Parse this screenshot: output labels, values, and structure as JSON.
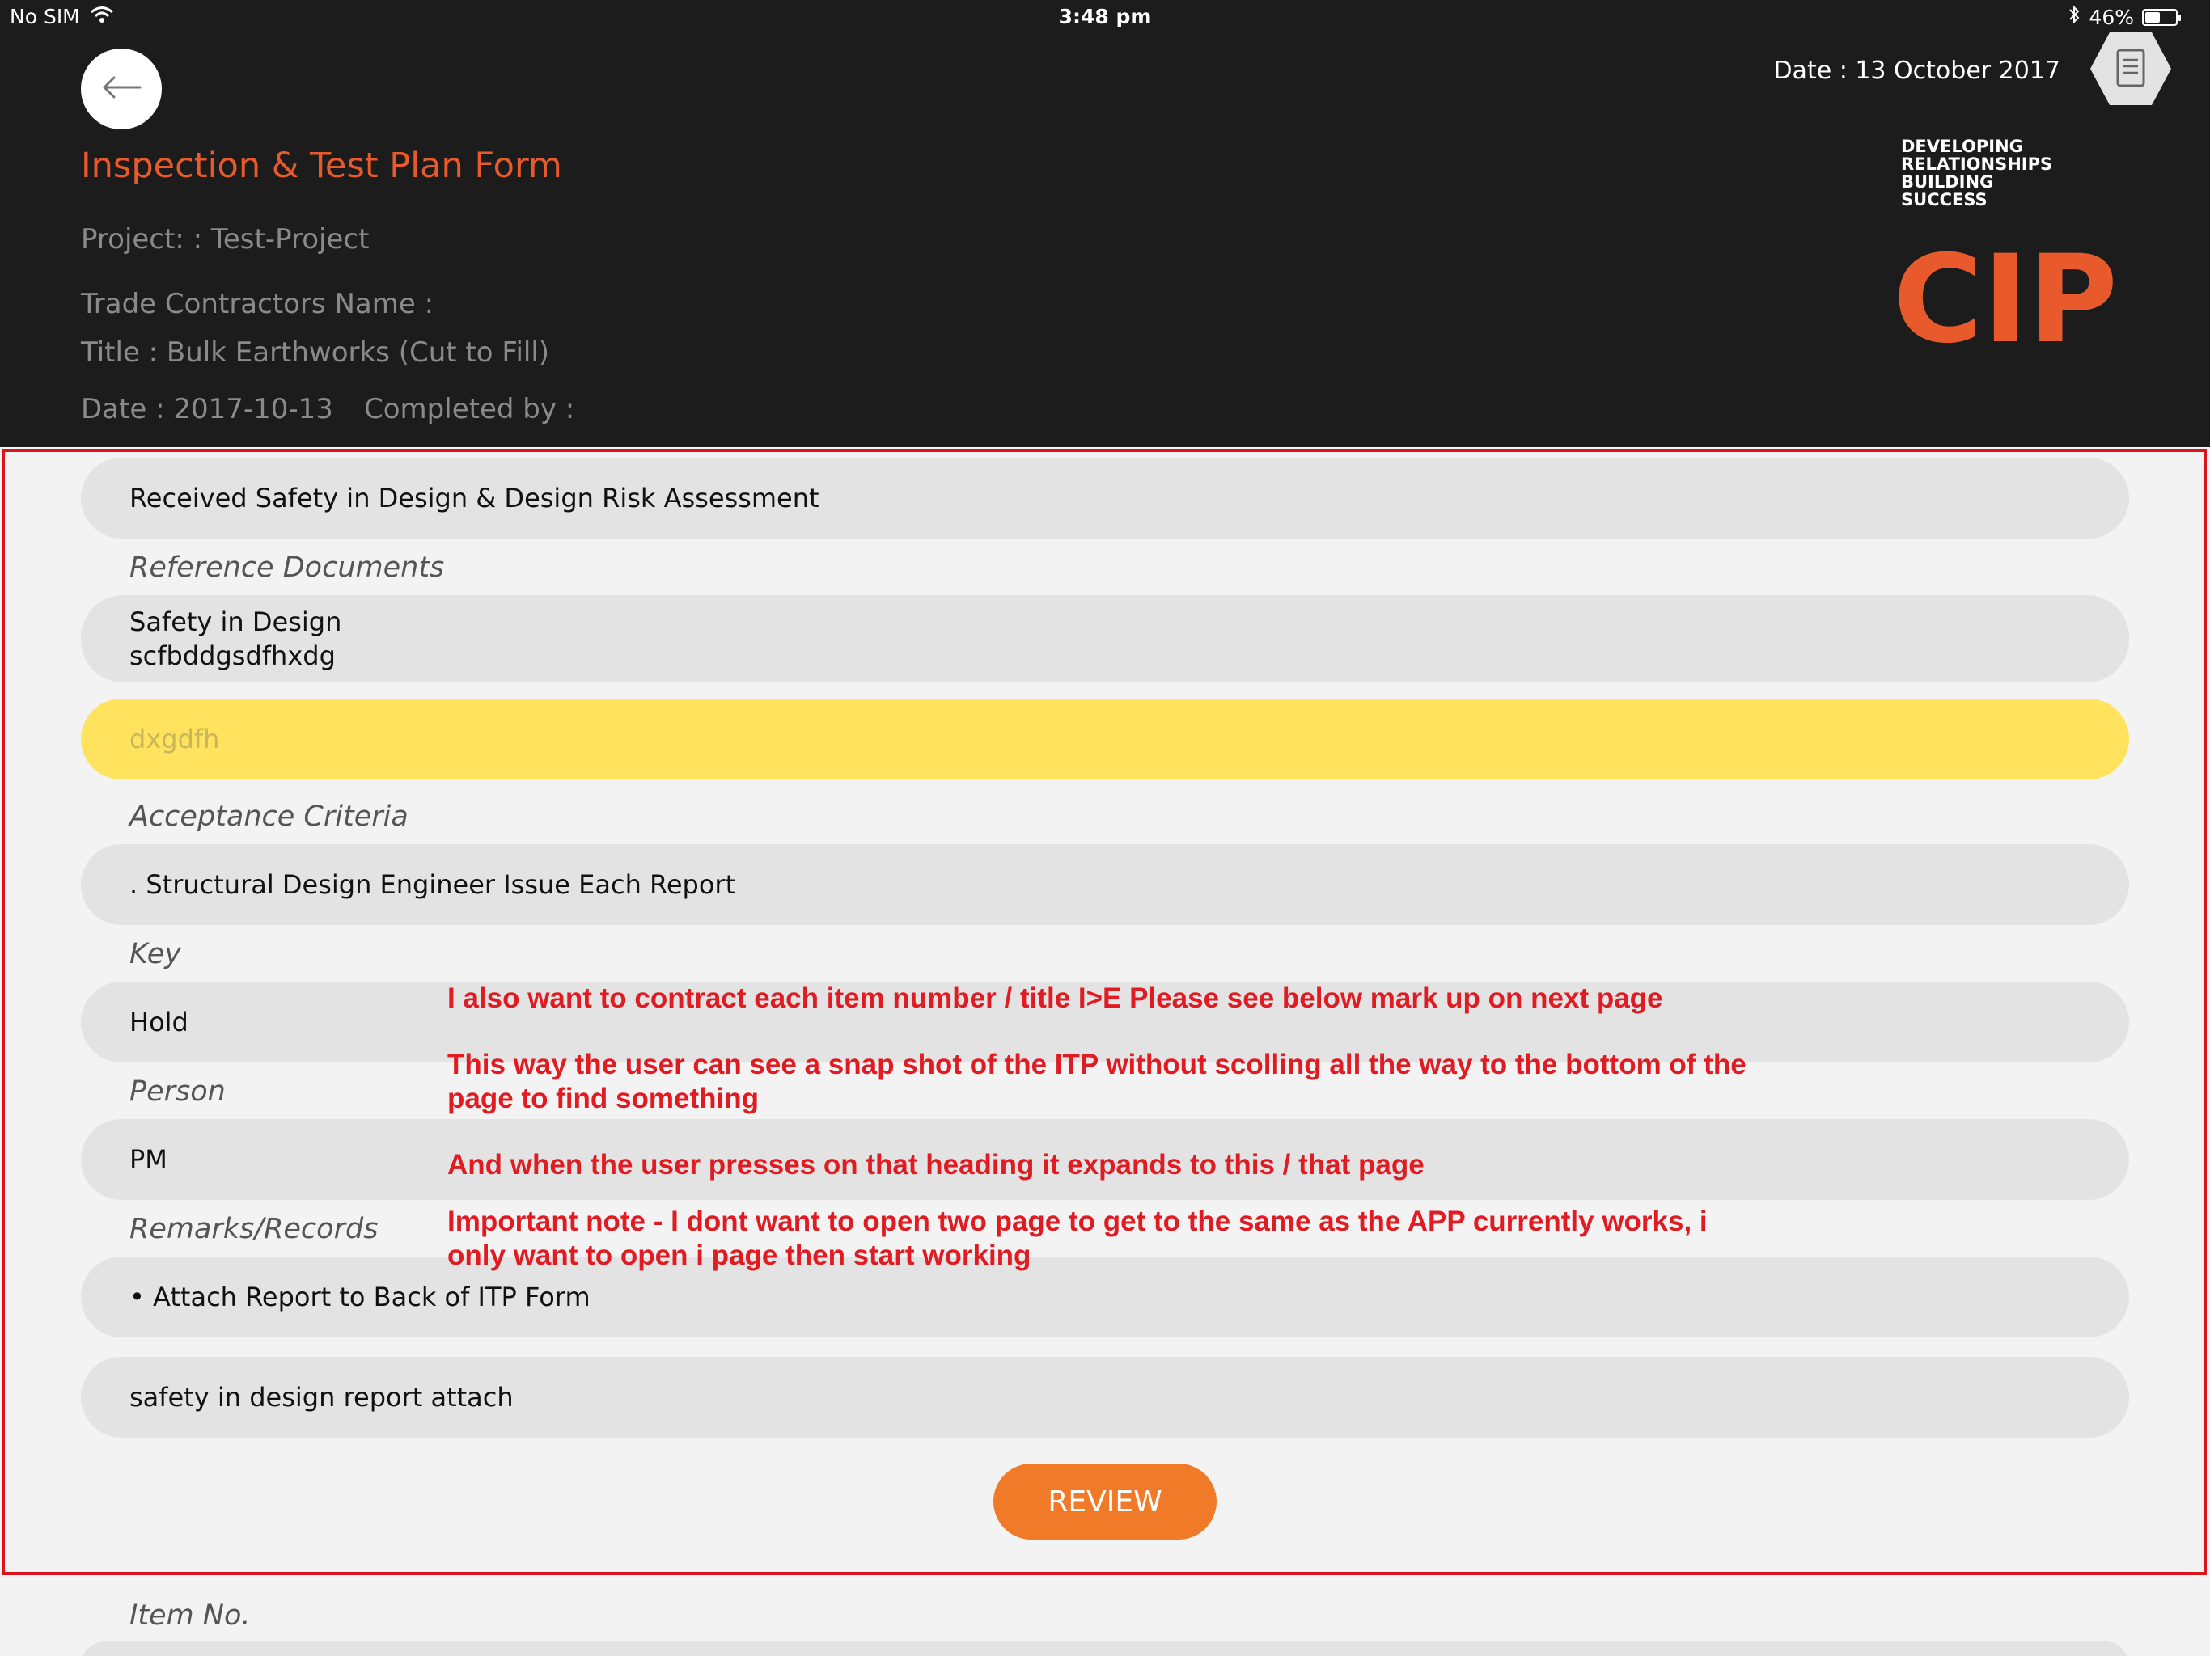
{
  "status_bar": {
    "carrier": "No SIM",
    "time": "3:48 pm",
    "battery": "46%",
    "battery_level": 0.46
  },
  "header": {
    "date_top": "Date : 13 October 2017",
    "form_title": "Inspection & Test Plan Form",
    "project": "Project: : Test-Project",
    "trade_contractors": "Trade Contractors Name  :",
    "title": "Title : Bulk Earthworks (Cut to Fill)",
    "date": "Date : 2017-10-13",
    "completed_by": "Completed by :",
    "tagline": [
      "DEVELOPING",
      "RELATIONSHIPS",
      "BUILDING",
      "SUCCESS"
    ],
    "logo_text": "CIP"
  },
  "item": {
    "description": "Received Safety in Design & Design Risk Assessment",
    "reference_documents_label": "Reference Documents",
    "reference_documents": [
      "Safety in Design",
      "scfbddgsdfhxdg"
    ],
    "highlight_value": "dxgdfh",
    "acceptance_criteria_label": "Acceptance Criteria",
    "acceptance_criteria": ". Structural Design Engineer Issue Each Report",
    "key_label": "Key",
    "key": "Hold",
    "person_label": "Person",
    "person": "PM",
    "remarks_label": "Remarks/Records",
    "remarks": "• Attach Report to Back of ITP Form",
    "comment": "safety in design report attach",
    "review_button": "REVIEW"
  },
  "next_item": {
    "label": "Item No."
  },
  "annotations": [
    "I also want to contract each item number / title I>E Please see below mark up on next page",
    "This way the user can see a snap shot of the ITP without scolling all the way to the bottom of the",
    "page to find something",
    "And when the user presses on that heading it expands to this / that page",
    "Important note - I dont want to open two page to get to the same as the APP currently works, i",
    "only want to open i page then start working"
  ],
  "colors": {
    "header_bg": "#1c1c1c",
    "accent_orange": "#e85a2b",
    "review_button": "#f07a27",
    "highlight_yellow": "#ffe25e",
    "annotation_red": "#e01b22"
  }
}
